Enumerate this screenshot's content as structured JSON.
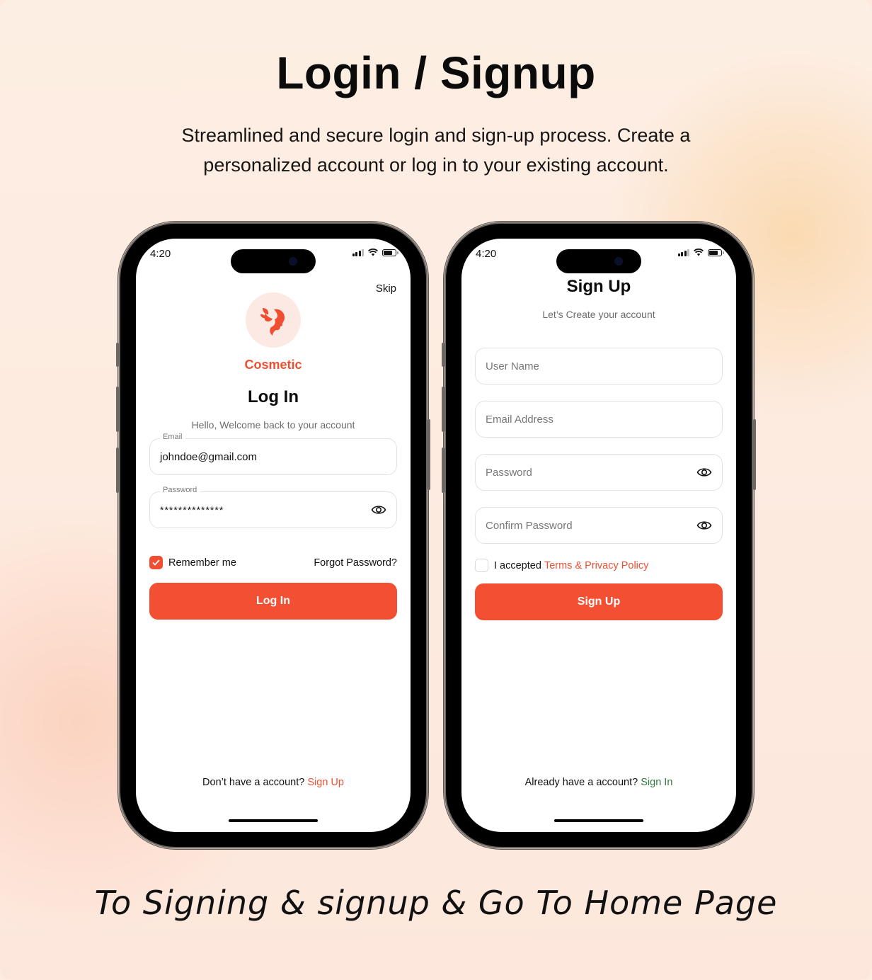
{
  "hero": {
    "title": "Login / Signup",
    "subtitle": "Streamlined and secure login and sign-up process. Create a personalized account or log in to your existing account."
  },
  "caption": "To Signing & signup & Go To Home Page",
  "colors": {
    "accent": "#f34f33",
    "link_green": "#2f7a3e",
    "background": "#fdebe0"
  },
  "status_bar": {
    "time": "4:20",
    "icons": [
      "signal-icon",
      "wifi-icon",
      "battery-icon"
    ]
  },
  "login": {
    "skip_label": "Skip",
    "logo_icon": "woman-profile-leaf-icon",
    "brand": "Cosmetic",
    "title": "Log In",
    "subtitle": "Hello, Welcome back to your account",
    "email": {
      "label": "Email",
      "value": "johndoe@gmail.com"
    },
    "password": {
      "label": "Password",
      "value": "**************"
    },
    "remember_me": {
      "label": "Remember me",
      "checked": true
    },
    "forgot_password": "Forgot Password?",
    "submit_label": "Log In",
    "footer_text": "Don’t have a account?",
    "footer_link": "Sign Up"
  },
  "signup": {
    "title": "Sign Up",
    "subtitle": "Let’s Create your account",
    "fields": [
      {
        "placeholder": "User Name",
        "has_eye": false
      },
      {
        "placeholder": "Email Address",
        "has_eye": false
      },
      {
        "placeholder": "Password",
        "has_eye": true
      },
      {
        "placeholder": "Confirm Password",
        "has_eye": true
      }
    ],
    "terms": {
      "prefix": "I accepted",
      "link": "Terms & Privacy Policy",
      "checked": false
    },
    "submit_label": "Sign Up",
    "footer_text": "Already have a account?",
    "footer_link": "Sign In"
  }
}
